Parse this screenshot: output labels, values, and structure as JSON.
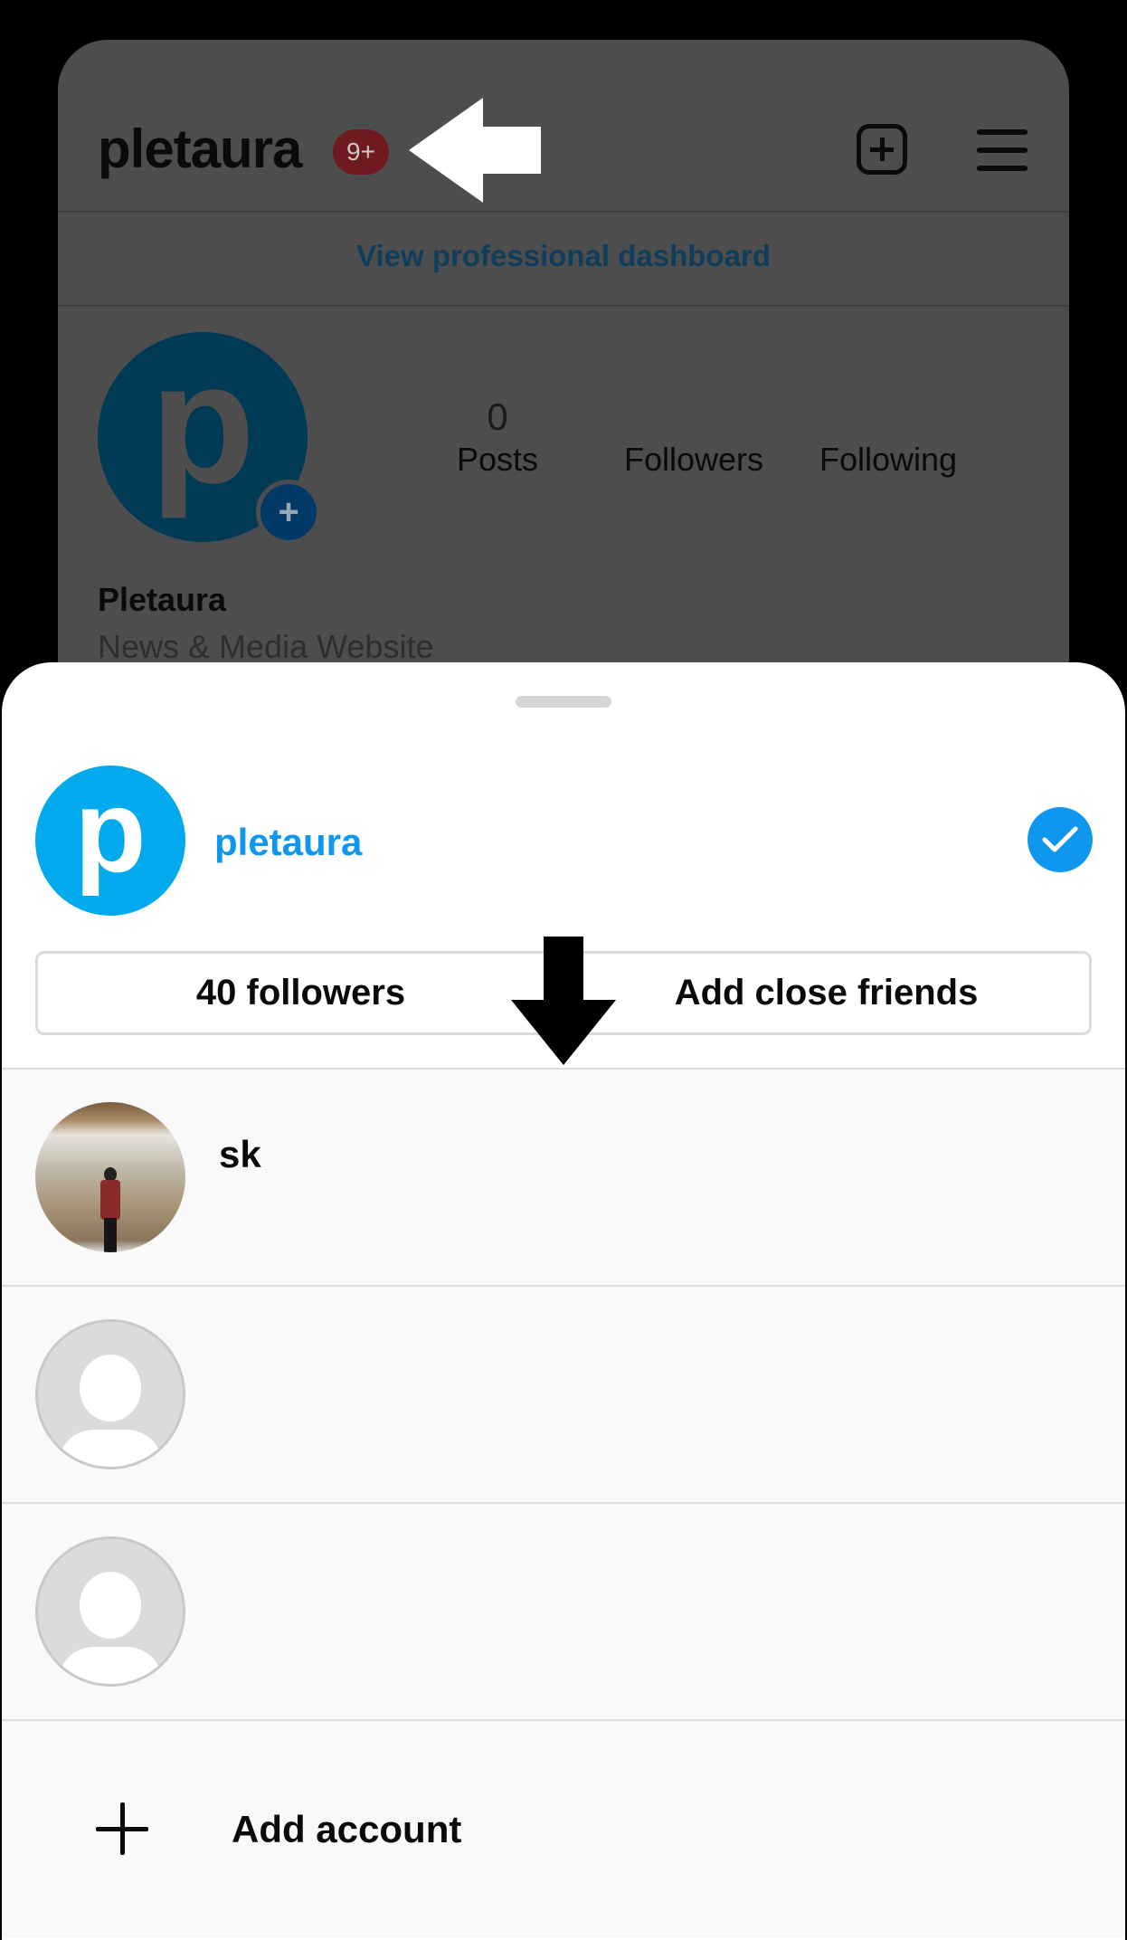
{
  "background_profile": {
    "header": {
      "username": "pletaura",
      "notification_badge": "9+",
      "create_icon": "plus-square-icon",
      "menu_icon": "hamburger-menu-icon"
    },
    "dashboard_link": "View professional dashboard",
    "avatar_letter": "p",
    "stats": [
      {
        "value": "0",
        "label": "Posts"
      },
      {
        "value": "",
        "label": "Followers"
      },
      {
        "value": "",
        "label": "Following"
      }
    ],
    "display_name": "Pletaura",
    "bio": "News & Media Website"
  },
  "annotations": {
    "left_arrow": "white-arrow-left pointing at username",
    "down_arrow": "black-arrow-down pointing at account list"
  },
  "account_sheet": {
    "current_account": {
      "avatar_letter": "p",
      "username": "pletaura",
      "selected": true
    },
    "buttons": {
      "followers": "40 followers",
      "close_friends": "Add close friends"
    },
    "accounts": [
      {
        "username": "sk",
        "avatar": "photo"
      },
      {
        "username": "",
        "avatar": "default"
      },
      {
        "username": "",
        "avatar": "default"
      }
    ],
    "add_account_label": "Add account"
  },
  "colors": {
    "accent_blue": "#0f97ef",
    "avatar_blue": "#02a9ec",
    "badge_red": "#6e1a1e"
  }
}
